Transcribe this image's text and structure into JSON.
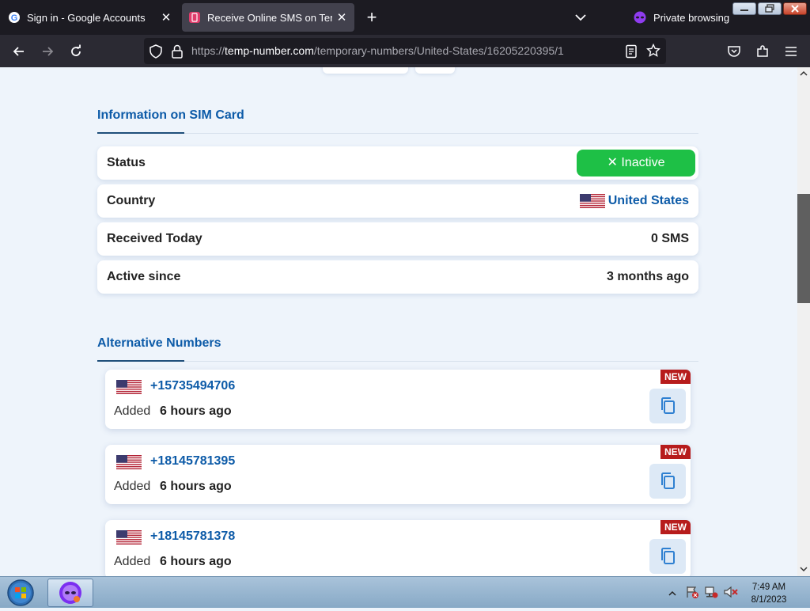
{
  "browser": {
    "tabs": [
      {
        "title": "Sign in - Google Accounts",
        "active": false
      },
      {
        "title": "Receive Online SMS on Temporary Numbers",
        "active": true
      }
    ],
    "private_label": "Private browsing",
    "url": {
      "scheme": "https://",
      "host": "temp-number.com",
      "path": "/temporary-numbers/United-States/16205220395/1"
    }
  },
  "sim_info": {
    "title": "Information on SIM Card",
    "rows": [
      {
        "label": "Status",
        "value": "✕ Inactive"
      },
      {
        "label": "Country",
        "value": "United States"
      },
      {
        "label": "Received Today",
        "value": "0 SMS"
      },
      {
        "label": "Active since",
        "value": "3 months ago"
      }
    ]
  },
  "alternatives": {
    "title": "Alternative Numbers",
    "items": [
      {
        "number": "+15735494706",
        "added_label": "Added",
        "added_value": "6 hours ago",
        "badge": "NEW"
      },
      {
        "number": "+18145781395",
        "added_label": "Added",
        "added_value": "6 hours ago",
        "badge": "NEW"
      },
      {
        "number": "+18145781378",
        "added_label": "Added",
        "added_value": "6 hours ago",
        "badge": "NEW"
      }
    ]
  },
  "taskbar": {
    "time": "7:49 AM",
    "date": "8/1/2023"
  },
  "colors": {
    "accent_blue": "#0d5ba8",
    "status_green": "#1ec046",
    "new_badge_red": "#b71c1c",
    "page_bg": "#eef4fb"
  }
}
